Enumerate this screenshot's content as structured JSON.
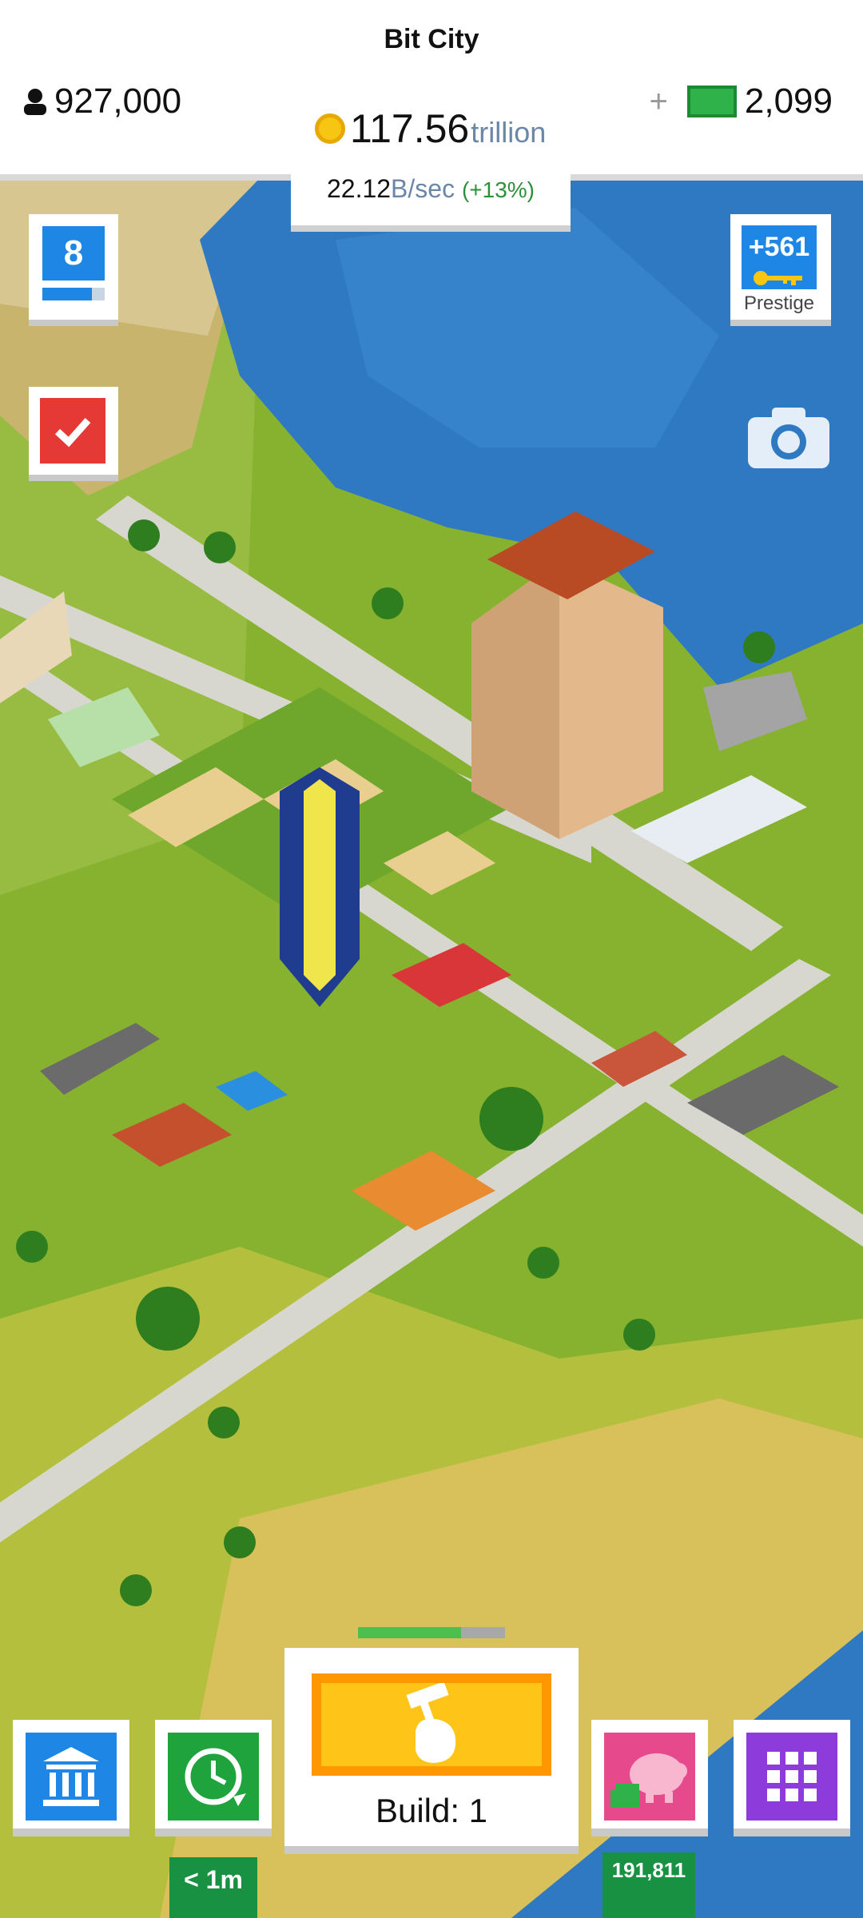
{
  "header": {
    "title": "Bit City",
    "population": "927,000",
    "coins_value": "117.56",
    "coins_unit": "trillion",
    "cash_plus": "+",
    "cash_value": "2,099"
  },
  "income": {
    "value": "22.12",
    "unit": "B/sec",
    "bonus": "(+13%)"
  },
  "level": {
    "number": "8",
    "progress": 0.8
  },
  "prestige": {
    "reward": "+561",
    "label": "Prestige"
  },
  "build": {
    "label": "Build: 1",
    "progress": 0.7
  },
  "bottom": {
    "timer": "< 1m",
    "piggy_count": "191,811"
  },
  "colors": {
    "accent_blue": "#1e87e5",
    "build_yellow": "#fec417",
    "build_orange": "#ff9800",
    "green_badge": "#189142",
    "task_red": "#e53935",
    "menu_purple": "#8e3bdb",
    "piggy_pink": "#e64a8c"
  },
  "icons": {
    "population": "person-icon",
    "coin": "coin-icon",
    "cash": "cash-icon",
    "task": "checkmark-icon",
    "camera": "camera-icon",
    "bank": "bank-icon",
    "timer": "clock-refresh-icon",
    "build": "hammer-hand-icon",
    "piggy": "piggy-bank-icon",
    "menu": "grid-menu-icon"
  }
}
